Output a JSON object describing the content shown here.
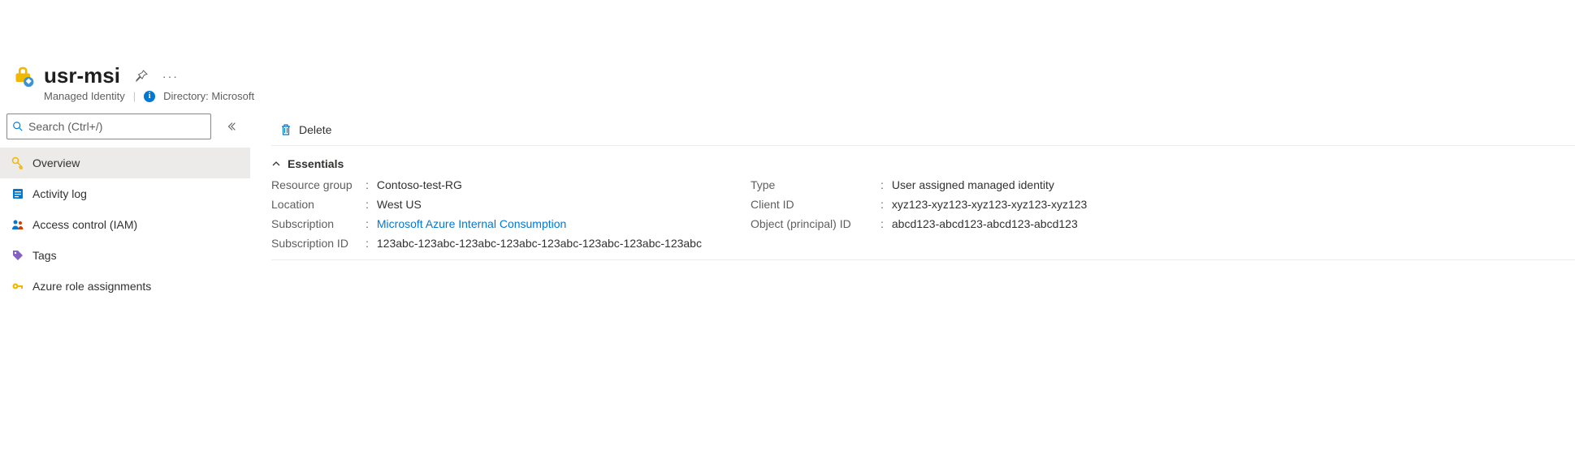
{
  "header": {
    "title": "usr-msi",
    "resource_type": "Managed Identity",
    "directory_label": "Directory: Microsoft"
  },
  "sidebar": {
    "search_placeholder": "Search (Ctrl+/)",
    "items": [
      {
        "label": "Overview",
        "icon": "key-icon",
        "active": true
      },
      {
        "label": "Activity log",
        "icon": "log-icon",
        "active": false
      },
      {
        "label": "Access control (IAM)",
        "icon": "people-icon",
        "active": false
      },
      {
        "label": "Tags",
        "icon": "tag-icon",
        "active": false
      },
      {
        "label": "Azure role assignments",
        "icon": "key-simple-icon",
        "active": false
      }
    ]
  },
  "toolbar": {
    "delete_label": "Delete"
  },
  "essentials": {
    "header_label": "Essentials",
    "left": {
      "resource_group": {
        "label": "Resource group",
        "value": "Contoso-test-RG"
      },
      "location": {
        "label": "Location",
        "value": "West US"
      },
      "subscription": {
        "label": "Subscription",
        "value": "Microsoft Azure Internal Consumption"
      },
      "subscription_id": {
        "label": "Subscription ID",
        "value": "123abc-123abc-123abc-123abc-123abc-123abc-123abc-123abc"
      }
    },
    "right": {
      "type": {
        "label": "Type",
        "value": "User assigned managed identity"
      },
      "client_id": {
        "label": "Client ID",
        "value": "xyz123-xyz123-xyz123-xyz123-xyz123"
      },
      "object_id": {
        "label": "Object (principal) ID",
        "value": "abcd123-abcd123-abcd123-abcd123"
      }
    }
  }
}
